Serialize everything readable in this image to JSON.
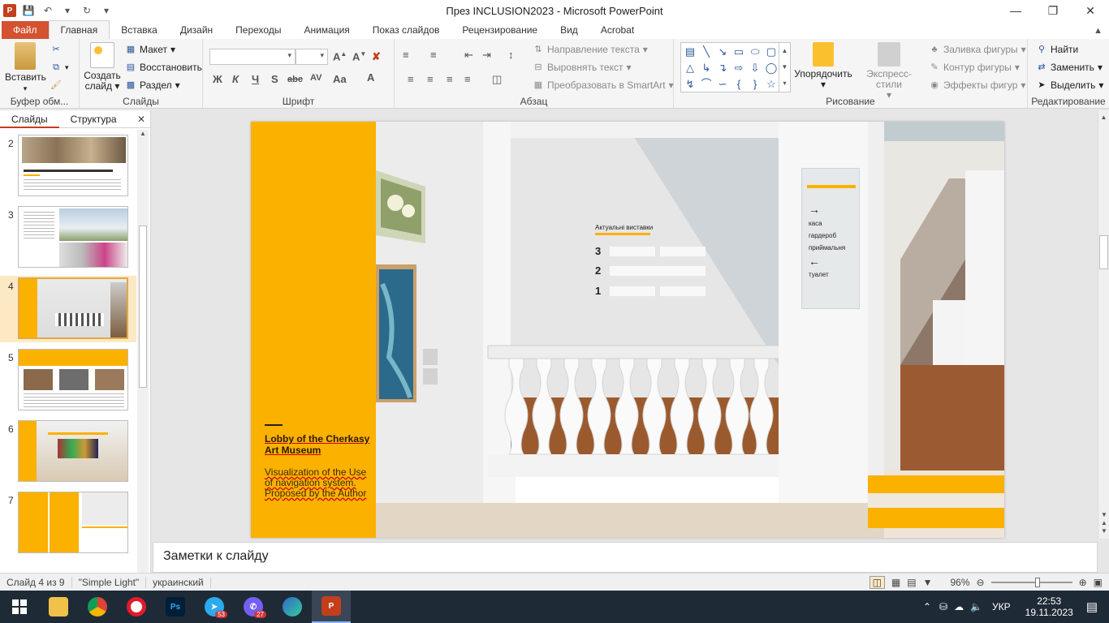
{
  "window": {
    "title": "През INCLUSION2023  -  Microsoft PowerPoint"
  },
  "tabs": [
    "Файл",
    "Главная",
    "Вставка",
    "Дизайн",
    "Переходы",
    "Анимация",
    "Показ слайдов",
    "Рецензирование",
    "Вид",
    "Acrobat"
  ],
  "ribbon": {
    "clipboard": {
      "label": "Буфер обм...",
      "paste": "Вставить"
    },
    "slides": {
      "label": "Слайды",
      "new_slide": "Создать слайд",
      "layout": "Макет",
      "reset": "Восстановить",
      "section": "Раздел"
    },
    "font": {
      "label": "Шрифт"
    },
    "paragraph": {
      "label": "Абзац",
      "text_direction": "Направление текста",
      "align_text": "Выровнять текст",
      "smartart": "Преобразовать в SmartArt"
    },
    "drawing": {
      "label": "Рисование",
      "arrange": "Упорядочить",
      "quick_styles": "Экспресс-стили",
      "shape_fill": "Заливка фигуры",
      "shape_outline": "Контур фигуры",
      "shape_effects": "Эффекты фигур"
    },
    "editing": {
      "label": "Редактирование",
      "find": "Найти",
      "replace": "Заменить",
      "select": "Выделить"
    }
  },
  "left_pane": {
    "tabs": [
      "Слайды",
      "Структура"
    ],
    "slides": [
      {
        "num": "2"
      },
      {
        "num": "3"
      },
      {
        "num": "4",
        "selected": true
      },
      {
        "num": "5"
      },
      {
        "num": "6"
      },
      {
        "num": "7"
      }
    ]
  },
  "slide": {
    "title": "Lobby of the Cherkasy Art Museum",
    "subtitle": "Visualization of the Use of navigation system. Proposed by the Author",
    "sign_exhibitions": {
      "heading": "Актуальні виставки",
      "floors": [
        "3",
        "2",
        "1"
      ]
    },
    "sign_directions": [
      "каса",
      "гардероб",
      "приймальня",
      "туалет"
    ]
  },
  "notes_placeholder": "Заметки к слайду",
  "status": {
    "slide_of": "Слайд 4 из 9",
    "theme": "\"Simple Light\"",
    "language": "украинский",
    "zoom": "96%"
  },
  "taskbar": {
    "badges": {
      "telegram": "53",
      "viber": "27"
    },
    "lang": "УКР",
    "time": "22:53",
    "date": "19.11.2023"
  }
}
